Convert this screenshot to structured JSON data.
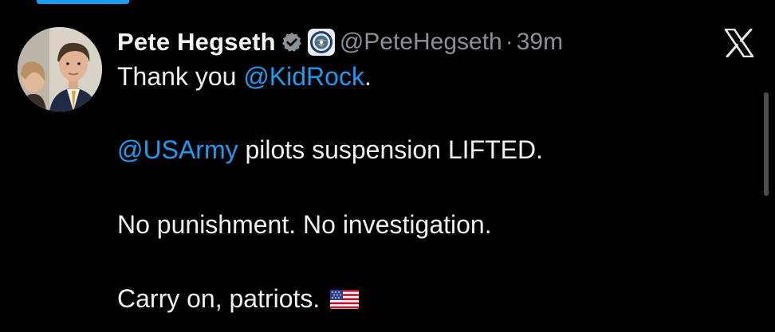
{
  "author": {
    "display_name": "Pete Hegseth",
    "handle": "@PeteHegseth",
    "separator": "·",
    "timestamp": "39m",
    "verified_badge_color": "#8b9096",
    "affiliate_badge": "department-of-defense-seal-icon"
  },
  "platform": {
    "logo_icon": "x-logo-icon"
  },
  "tweet": {
    "line1_prefix": "Thank you ",
    "line1_mention": "@KidRock",
    "line1_suffix": ".",
    "line2_mention": "@USArmy",
    "line2_text": " pilots suspension LIFTED.",
    "line3_text": "No punishment. No investigation.",
    "line4_text": "Carry on, patriots.",
    "line4_emoji": "us-flag-emoji"
  },
  "colors": {
    "background": "#000000",
    "mention": "#1d9bf0",
    "secondary_text": "#8b9096",
    "primary_text": "#e7e9ea"
  }
}
